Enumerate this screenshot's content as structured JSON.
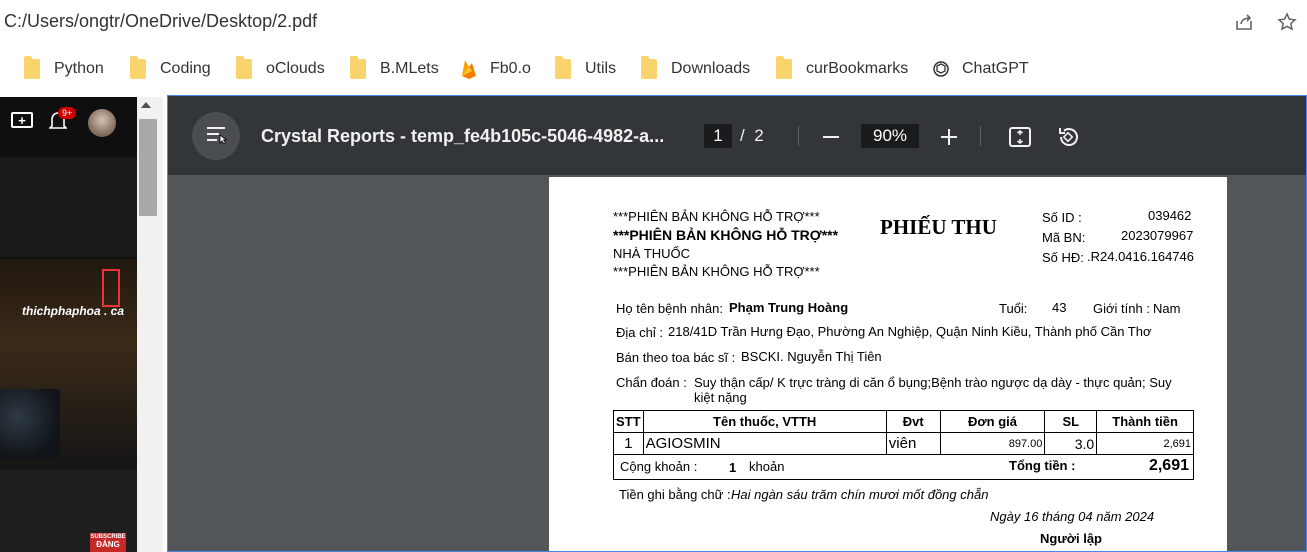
{
  "browser": {
    "url": "C:/Users/ongtr/OneDrive/Desktop/2.pdf",
    "icons": {
      "share": "share-icon",
      "star": "star-icon"
    }
  },
  "bookmarks": [
    {
      "label": "Python",
      "icon": "folder-icon"
    },
    {
      "label": "Coding",
      "icon": "folder-icon"
    },
    {
      "label": "oClouds",
      "icon": "folder-icon"
    },
    {
      "label": "B.MLets",
      "icon": "folder-icon"
    },
    {
      "label": "Fb0.o",
      "icon": "firebase-icon"
    },
    {
      "label": "Utils",
      "icon": "folder-icon"
    },
    {
      "label": "Downloads",
      "icon": "folder-icon"
    },
    {
      "label": "curBookmarks",
      "icon": "folder-icon"
    },
    {
      "label": "ChatGPT",
      "icon": "chatgpt-icon"
    }
  ],
  "left_pane": {
    "notification_count": "9+",
    "video_text": "thichphaphoa . ca",
    "subscribe_text": "SUBSCRIBE",
    "subscribe_vn": "ĐĂNG"
  },
  "pdf_viewer": {
    "title": "Crystal Reports - temp_fe4b105c-5046-4982-a...",
    "current_page": "1",
    "page_sep": "/",
    "total_pages": "2",
    "zoom": "90%"
  },
  "receipt": {
    "header_lines": [
      "***PHIÊN BẢN KHÔNG HỖ TRỢ***",
      "***PHIÊN BẢN KHÔNG HỖ TRỢ***",
      "NHÀ THUỐC",
      "***PHIÊN BẢN KHÔNG HỖ TRỢ***"
    ],
    "title": "PHIẾU THU",
    "id_label": "Số ID :",
    "id_value": "039462",
    "bn_label": "Mã BN:",
    "bn_value": "2023079967",
    "hd_label": "Số HĐ:",
    "hd_value": ".R24.0416.164746",
    "patient_label": "Họ tên bệnh nhân:",
    "patient_name": "Phạm Trung Hoàng",
    "age_label": "Tuổi:",
    "age_value": "43",
    "gender_label": "Giới tính :",
    "gender_value": "Nam",
    "address_label": "Địa chỉ :",
    "address_value": "218/41D Trần Hưng Đạo, Phường An Nghiệp, Quận Ninh Kiều, Thành phố Cần Thơ",
    "doctor_label": "Bán theo toa bác sĩ :",
    "doctor_value": "BSCKI. Nguyễn Thị Tiên",
    "diagnosis_label": "Chẩn đoán :",
    "diagnosis_line1": "Suy thận cấp/ K trực tràng di căn ổ bụng;Bệnh trào ngược dạ dày - thực quản; Suy",
    "diagnosis_line2": "kiệt nặng",
    "table_headers": [
      "STT",
      "Tên thuốc, VTTH",
      "Đvt",
      "Đơn giá",
      "SL",
      "Thành tiền"
    ],
    "table_rows": [
      {
        "stt": "1",
        "name": "AGIOSMIN",
        "unit": "viên",
        "price": "897.00",
        "qty": "3.0",
        "total": "2,691"
      }
    ],
    "count_label": "Cộng khoản :",
    "count_value": "1",
    "count_unit": "khoản",
    "total_label": "Tổng tiền :",
    "total_value": "2,691",
    "words_label": "Tiền ghi bằng chữ :",
    "words_value": "Hai ngàn sáu trăm chín mươi mốt đồng chẵn",
    "date_text": "Ngày 16 tháng 04 năm 2024",
    "signer_label": "Người lập"
  }
}
